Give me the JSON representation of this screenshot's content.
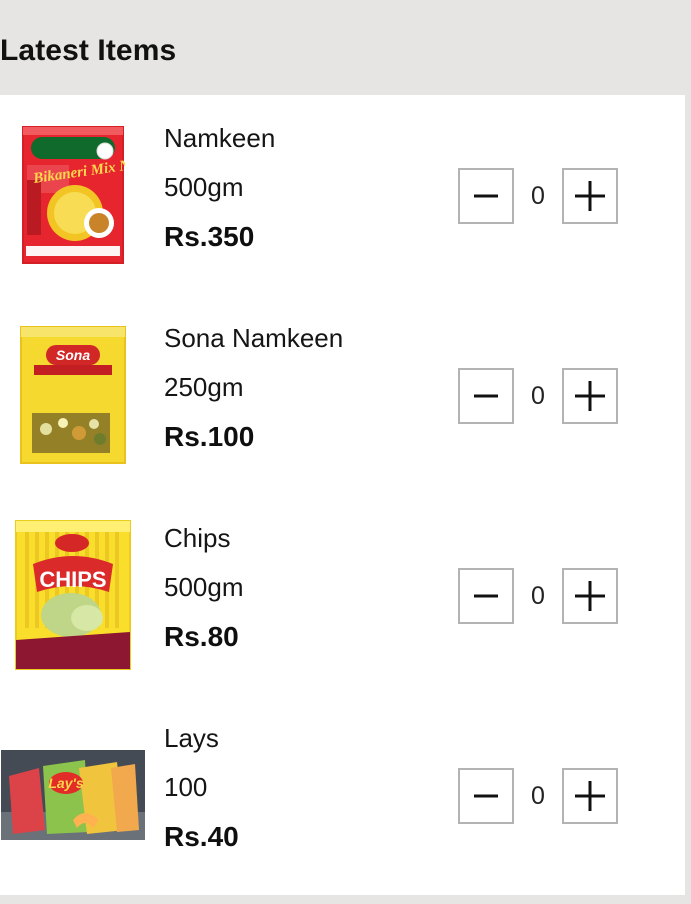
{
  "header": {
    "title": "Latest Items"
  },
  "items": [
    {
      "name": "Namkeen",
      "weight": "500gm",
      "price": "Rs.350",
      "quantity": "0",
      "image": "bikaneri-namkeen-pack",
      "image_text": "Bikaneri Mix Namkeen"
    },
    {
      "name": "Sona Namkeen",
      "weight": "250gm",
      "price": "Rs.100",
      "quantity": "0",
      "image": "sona-namkeen-pack",
      "image_text": "Sona"
    },
    {
      "name": "Chips",
      "weight": "500gm",
      "price": "Rs.80",
      "quantity": "0",
      "image": "haldiram-chips-pack",
      "image_text": "CHIPS"
    },
    {
      "name": "Lays",
      "weight": "100",
      "price": "Rs.40",
      "quantity": "0",
      "image": "lays-snacks-group",
      "image_text": "Lay's"
    }
  ],
  "icons": {
    "minus": "minus-icon",
    "plus": "plus-icon"
  },
  "colors": {
    "header_bg": "#e7e5e4",
    "panel_bg": "#ffffff",
    "button_border": "#b3b3b3"
  }
}
